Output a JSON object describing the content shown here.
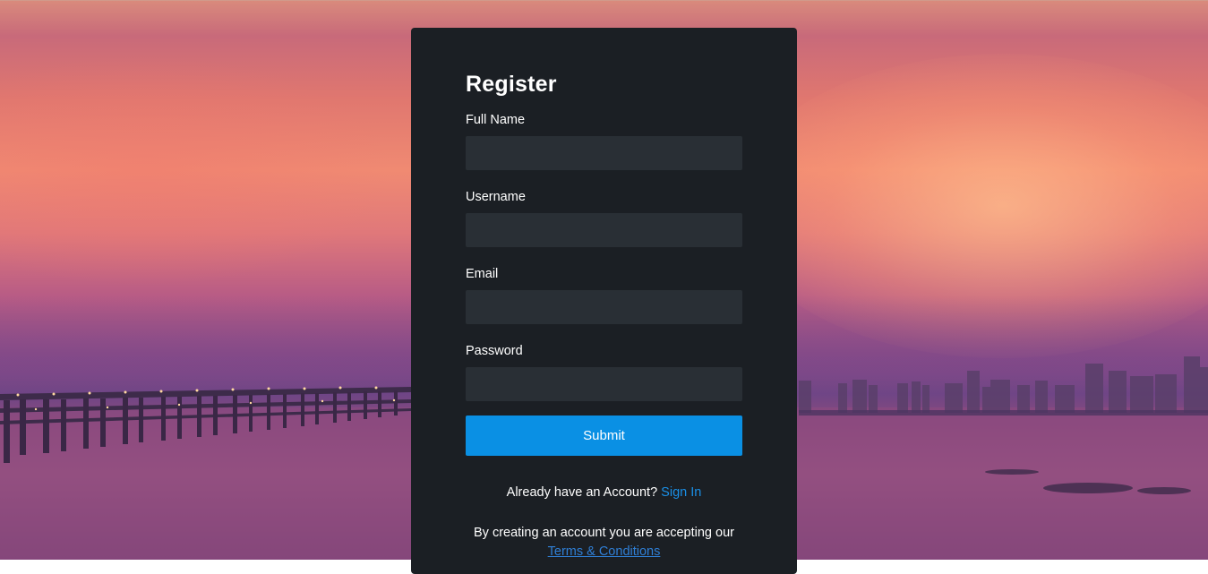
{
  "form": {
    "title": "Register",
    "fields": [
      {
        "label": "Full Name",
        "value": "",
        "placeholder": ""
      },
      {
        "label": "Username",
        "value": "",
        "placeholder": ""
      },
      {
        "label": "Email",
        "value": "",
        "placeholder": ""
      },
      {
        "label": "Password",
        "value": "",
        "placeholder": ""
      }
    ],
    "submit_label": "Submit",
    "signin_prompt": "Already have an Account?",
    "signin_link": "Sign In",
    "terms_prompt": "By creating an account you are accepting our",
    "terms_link": "Terms & Conditions"
  },
  "colors": {
    "card_background": "#1b1f24",
    "input_background": "#292f35",
    "submit_button": "#0a90e4",
    "link": "#1a8fe6"
  }
}
